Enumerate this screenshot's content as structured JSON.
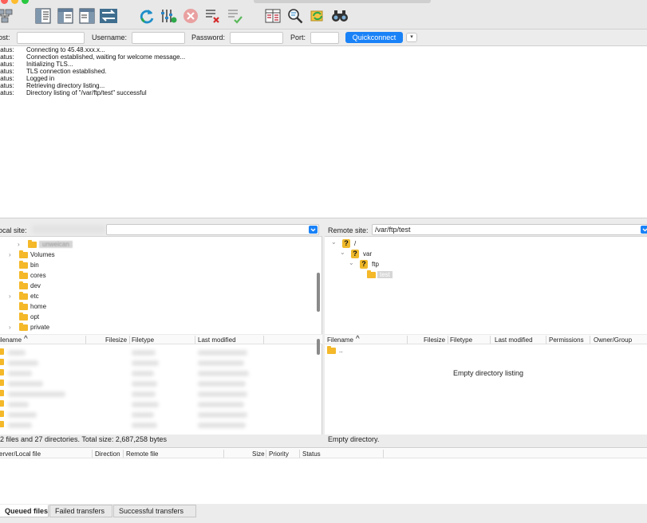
{
  "toolbar": {
    "icons": [
      "site-manager-icon",
      "toggle-message-log-icon",
      "toggle-local-tree-icon",
      "toggle-remote-tree-icon",
      "toggle-transfer-queue-icon",
      "refresh-icon",
      "process-queue-icon",
      "cancel-icon",
      "disconnect-icon",
      "reconnect-icon",
      "directory-comparison-icon",
      "filter-icon",
      "synchronized-browsing-icon",
      "search-icon"
    ]
  },
  "quickconnect": {
    "host_label": "ost:",
    "username_label": "Username:",
    "password_label": "Password:",
    "port_label": "Port:",
    "button_label": "Quickconnect",
    "dropdown_glyph": "▾"
  },
  "log": {
    "lines": [
      {
        "key": "tatus:",
        "msg": "Connecting to 45.48.xxx.x..."
      },
      {
        "key": "tatus:",
        "msg": "Connection established, waiting for welcome message..."
      },
      {
        "key": "tatus:",
        "msg": "Initializing TLS..."
      },
      {
        "key": "tatus:",
        "msg": "TLS connection established."
      },
      {
        "key": "tatus:",
        "msg": "Logged in"
      },
      {
        "key": "tatus:",
        "msg": "Retrieving directory listing..."
      },
      {
        "key": "tatus:",
        "msg": "Directory listing of \"/var/ftp/test\" successful"
      }
    ]
  },
  "local": {
    "site_label": "ocal site:",
    "tree": [
      {
        "name": "unweican",
        "expand": "›",
        "selected": true
      },
      {
        "name": "Volumes",
        "expand": "›"
      },
      {
        "name": "bin",
        "expand": ""
      },
      {
        "name": "cores",
        "expand": ""
      },
      {
        "name": "dev",
        "expand": ""
      },
      {
        "name": "etc",
        "expand": "›"
      },
      {
        "name": "home",
        "expand": ""
      },
      {
        "name": "opt",
        "expand": ""
      },
      {
        "name": "private",
        "expand": "›"
      }
    ],
    "headers": {
      "filename": "ilename",
      "sort_glyph": "^",
      "filesize": "Filesize",
      "filetype": "Filetype",
      "modified": "Last modified"
    },
    "status": "2 files and 27 directories. Total size: 2,687,258 bytes"
  },
  "remote": {
    "site_label": "Remote site:",
    "path": "/var/ftp/test",
    "tree": [
      {
        "name": "/",
        "expand": "⌄",
        "kind": "unknown"
      },
      {
        "name": "var",
        "expand": "⌄",
        "kind": "unknown"
      },
      {
        "name": "ftp",
        "expand": "⌄",
        "kind": "unknown"
      },
      {
        "name": "test",
        "expand": "",
        "kind": "folder",
        "selected": true
      }
    ],
    "headers": {
      "filename": "Filename",
      "sort_glyph": "^",
      "filesize": "Filesize",
      "filetype": "Filetype",
      "modified": "Last modified",
      "permissions": "Permissions",
      "owner": "Owner/Group"
    },
    "parent_entry": "..",
    "empty_message": "Empty directory listing",
    "status": "Empty directory."
  },
  "queue": {
    "headers": {
      "server": "erver/Local file",
      "direction": "Direction",
      "remote": "Remote file",
      "size": "Size",
      "priority": "Priority",
      "status": "Status"
    },
    "tabs": [
      "Queued files",
      "Failed transfers",
      "Successful transfers"
    ]
  }
}
